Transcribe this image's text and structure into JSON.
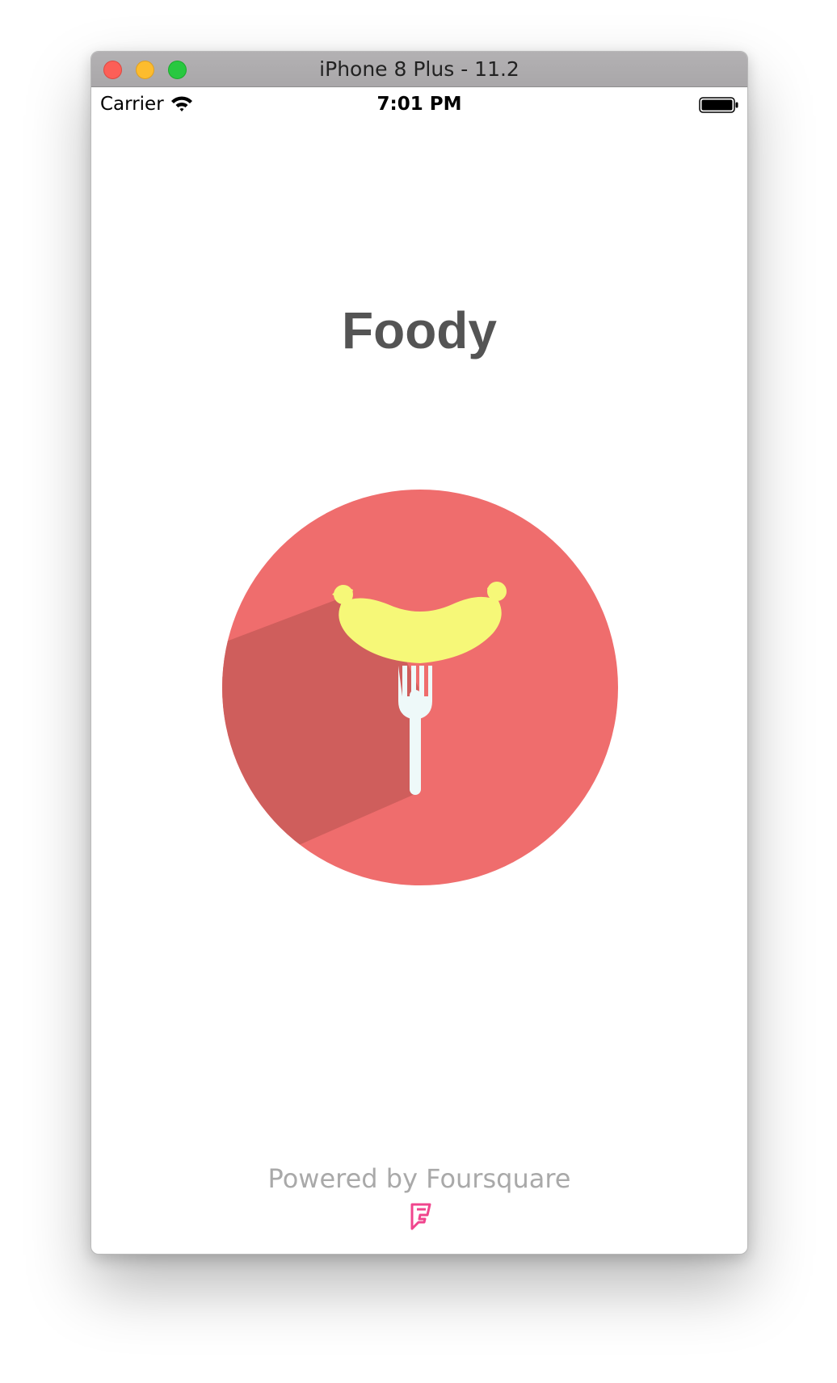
{
  "window": {
    "title": "iPhone 8 Plus - 11.2",
    "buttons": [
      "close",
      "minimize",
      "zoom"
    ]
  },
  "status_bar": {
    "carrier": "Carrier",
    "time": "7:01 PM",
    "icons": [
      "wifi-icon",
      "battery-icon"
    ]
  },
  "app": {
    "title": "Foody",
    "logo_icon": "sausage-on-fork-icon",
    "powered_by": "Powered by Foursquare",
    "footer_icon": "foursquare-icon"
  },
  "colors": {
    "logo_circle": "#ef6d6d",
    "logo_shadow": "#cf5e5c",
    "sausage": "#f6f878",
    "fork": "#eef9f9",
    "foursquare": "#f0458d"
  }
}
